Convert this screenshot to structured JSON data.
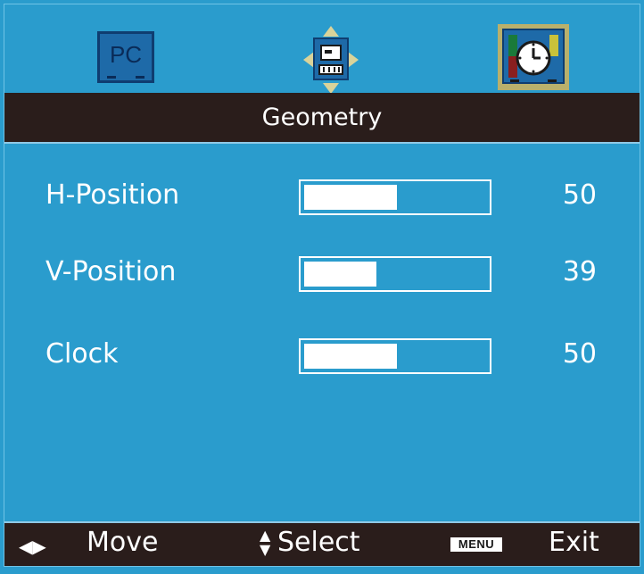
{
  "tabs": [
    {
      "label": "PC",
      "icon": "pc-monitor-icon"
    },
    {
      "label": "",
      "icon": "picture-adjust-icon"
    },
    {
      "label": "",
      "icon": "clock-monitor-icon",
      "selected": true
    }
  ],
  "title": "Geometry",
  "settings": [
    {
      "label": "H-Position",
      "value": "50",
      "level": 50
    },
    {
      "label": "V-Position",
      "value": "39",
      "level": 39
    },
    {
      "label": "Clock",
      "value": "50",
      "level": 50
    }
  ],
  "footer": {
    "move_label": "Move",
    "select_label": "Select",
    "menu_key": "MENU",
    "exit_label": "Exit"
  },
  "colors": {
    "background": "#2a9ccd",
    "bar_dark": "#2a1d1b",
    "selected_border": "#b9b06c"
  }
}
